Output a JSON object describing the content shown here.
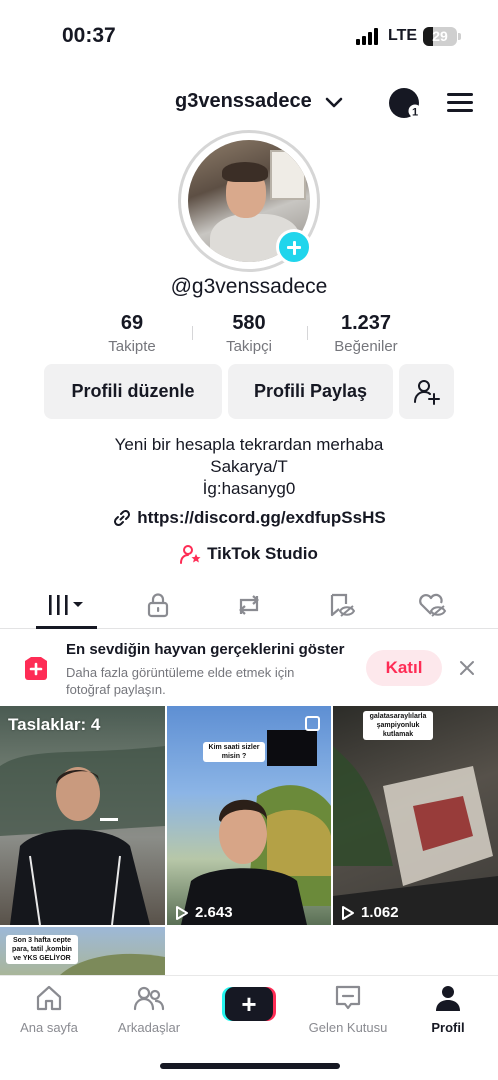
{
  "status_bar": {
    "time": "00:37",
    "network": "LTE",
    "battery": "29"
  },
  "header": {
    "username": "g3venssadece",
    "notification_count": "1"
  },
  "profile": {
    "handle": "@g3venssadece"
  },
  "stats": [
    {
      "value": "69",
      "label": "Takipte"
    },
    {
      "value": "580",
      "label": "Takipçi"
    },
    {
      "value": "1.237",
      "label": "Beğeniler"
    }
  ],
  "buttons": {
    "edit_profile": "Profili düzenle",
    "share_profile": "Profili Paylaş"
  },
  "bio": {
    "line1": "Yeni bir hesapla tekrardan merhaba",
    "line2": "Sakarya/T",
    "line3": "İg:hasanyg0",
    "link": "https://discord.gg/exdfupSsHS",
    "studio": "TikTok Studio"
  },
  "tabs": [
    {
      "name": "videos",
      "icon": "grid-icon",
      "active": true
    },
    {
      "name": "private",
      "icon": "lock-icon"
    },
    {
      "name": "reposts",
      "icon": "repost-icon"
    },
    {
      "name": "favorites",
      "icon": "bookmark-eye-icon"
    },
    {
      "name": "liked",
      "icon": "heart-eye-icon"
    }
  ],
  "suggestion": {
    "title": "En sevdiğin hayvan gerçeklerini göster",
    "description": "Daha fazla görüntüleme elde etmek için fotoğraf paylaşın.",
    "join_label": "Katıl"
  },
  "grid": {
    "drafts_label": "Taslaklar: 4",
    "videos": [
      {
        "views": ""
      },
      {
        "views": "2.643",
        "caption": "Kim saati sizler misin ?"
      },
      {
        "views": "1.062",
        "caption": "galatasaraylılarla şampiyonluk kutlamak"
      },
      {
        "views": "",
        "caption": "Son 3 hafta cepte para, tatil ,kombin ve YKS GELİYOR"
      }
    ]
  },
  "bottom_nav": [
    {
      "label": "Ana sayfa",
      "icon": "home-icon"
    },
    {
      "label": "Arkadaşlar",
      "icon": "friends-icon"
    },
    {
      "label": "",
      "icon": "create-plus-icon"
    },
    {
      "label": "Gelen Kutusu",
      "icon": "inbox-icon"
    },
    {
      "label": "Profil",
      "icon": "profile-icon",
      "active": true
    }
  ],
  "colors": {
    "accent": "#fe2c55",
    "cyan": "#25f4ee",
    "text": "#161823",
    "muted": "#75767c"
  }
}
